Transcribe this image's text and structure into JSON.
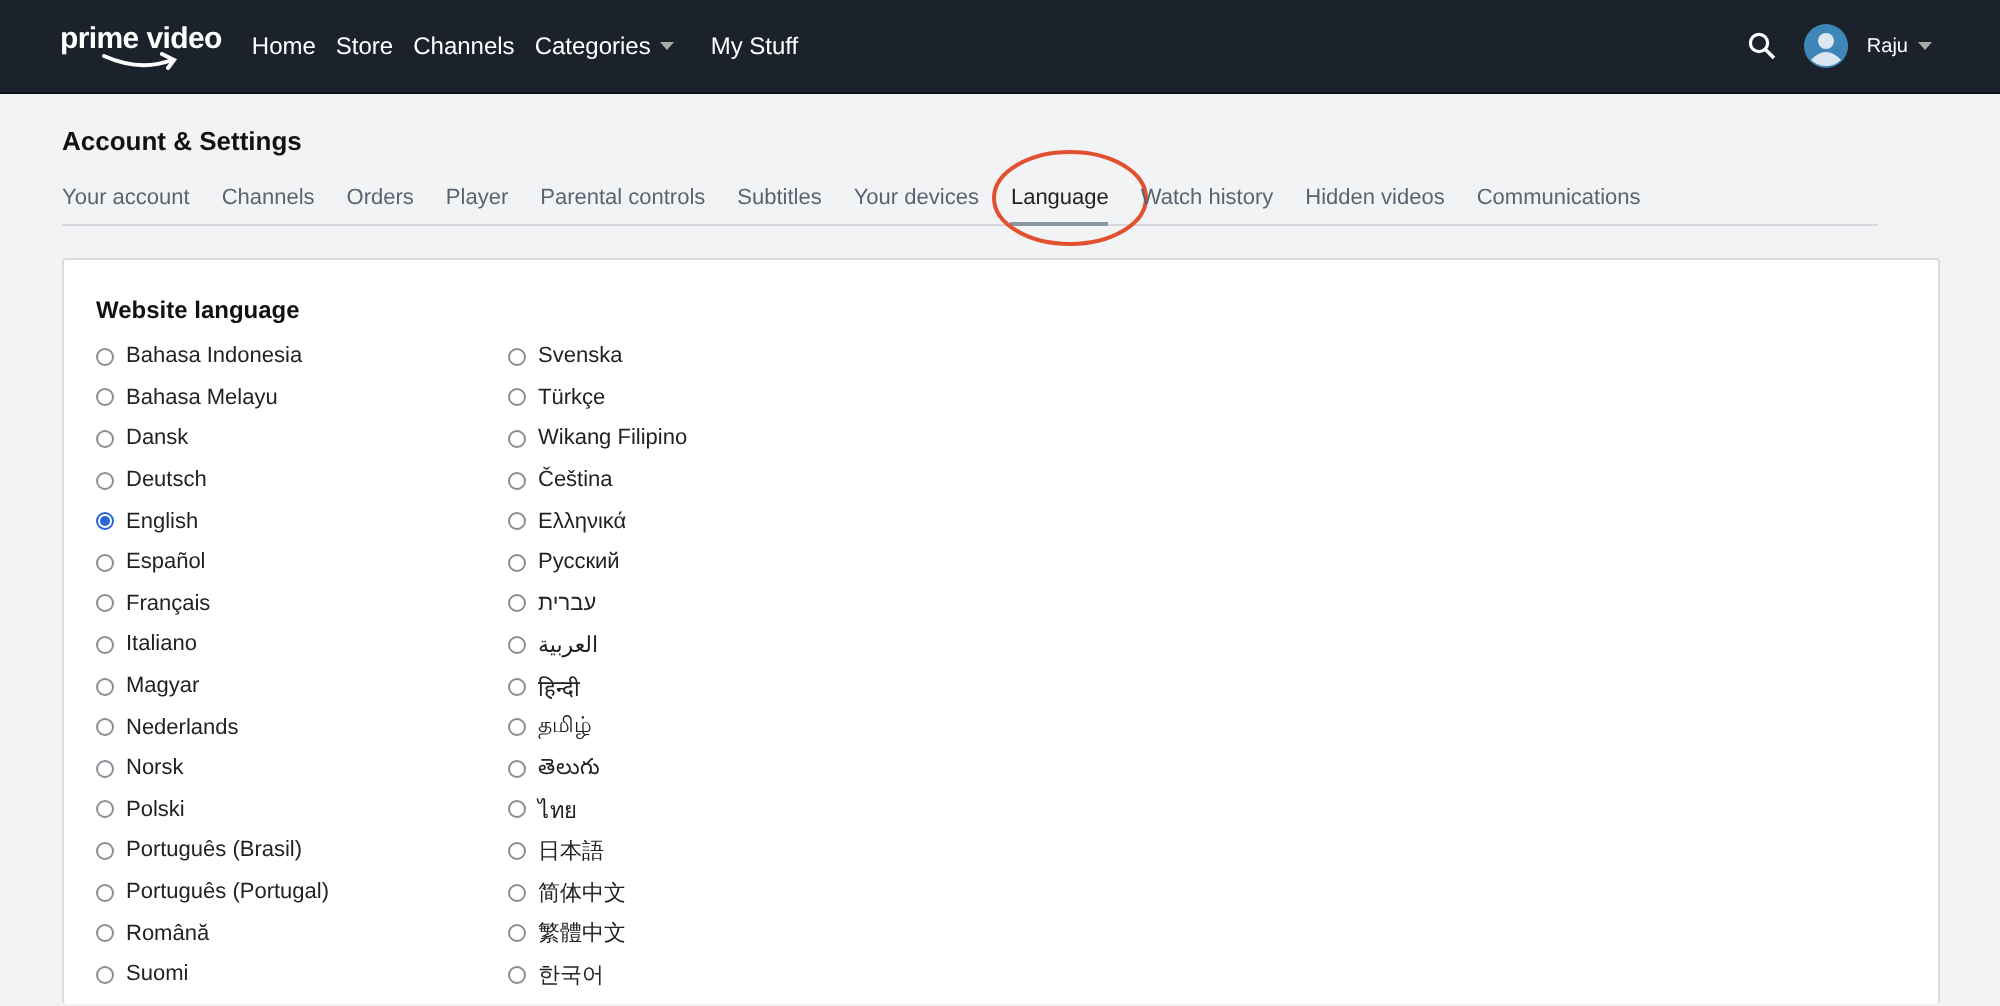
{
  "top_bar": {
    "logo": "prime video",
    "nav": [
      {
        "label": "Home",
        "dropdown": false
      },
      {
        "label": "Store",
        "dropdown": false
      },
      {
        "label": "Channels",
        "dropdown": false
      },
      {
        "label": "Categories",
        "dropdown": true
      },
      {
        "label": "My Stuff",
        "dropdown": false
      }
    ],
    "user": {
      "name": "Raju"
    }
  },
  "page_title": "Account & Settings",
  "tabs": [
    {
      "label": "Your account",
      "selected": false,
      "circled": false
    },
    {
      "label": "Channels",
      "selected": false,
      "circled": false
    },
    {
      "label": "Orders",
      "selected": false,
      "circled": false
    },
    {
      "label": "Player",
      "selected": false,
      "circled": false
    },
    {
      "label": "Parental controls",
      "selected": false,
      "circled": false
    },
    {
      "label": "Subtitles",
      "selected": false,
      "circled": false
    },
    {
      "label": "Your devices",
      "selected": false,
      "circled": false
    },
    {
      "label": "Language",
      "selected": true,
      "circled": true
    },
    {
      "label": "Watch history",
      "selected": false,
      "circled": false
    },
    {
      "label": "Hidden videos",
      "selected": false,
      "circled": false
    },
    {
      "label": "Communications",
      "selected": false,
      "circled": false
    }
  ],
  "website_language": {
    "heading": "Website language",
    "options": [
      {
        "label": "Bahasa Indonesia",
        "selected": false
      },
      {
        "label": "Bahasa Melayu",
        "selected": false
      },
      {
        "label": "Dansk",
        "selected": false
      },
      {
        "label": "Deutsch",
        "selected": false
      },
      {
        "label": "English",
        "selected": true
      },
      {
        "label": "Español",
        "selected": false
      },
      {
        "label": "Français",
        "selected": false
      },
      {
        "label": "Italiano",
        "selected": false
      },
      {
        "label": "Magyar",
        "selected": false
      },
      {
        "label": "Nederlands",
        "selected": false
      },
      {
        "label": "Norsk",
        "selected": false
      },
      {
        "label": "Polski",
        "selected": false
      },
      {
        "label": "Português (Brasil)",
        "selected": false
      },
      {
        "label": "Português (Portugal)",
        "selected": false
      },
      {
        "label": "Română",
        "selected": false
      },
      {
        "label": "Suomi",
        "selected": false
      },
      {
        "label": "Svenska",
        "selected": false
      },
      {
        "label": "Türkçe",
        "selected": false
      },
      {
        "label": "Wikang Filipino",
        "selected": false
      },
      {
        "label": "Čeština",
        "selected": false
      },
      {
        "label": "Ελληνικά",
        "selected": false
      },
      {
        "label": "Русский",
        "selected": false
      },
      {
        "label": "עברית",
        "selected": false
      },
      {
        "label": "العربية",
        "selected": false
      },
      {
        "label": "हिन्दी",
        "selected": false
      },
      {
        "label": "தமிழ்",
        "selected": false
      },
      {
        "label": "తెలుగు",
        "selected": false
      },
      {
        "label": "ไทย",
        "selected": false
      },
      {
        "label": "日本語",
        "selected": false
      },
      {
        "label": "简体中文",
        "selected": false
      },
      {
        "label": "繁體中文",
        "selected": false
      },
      {
        "label": "한국어",
        "selected": false
      }
    ]
  }
}
